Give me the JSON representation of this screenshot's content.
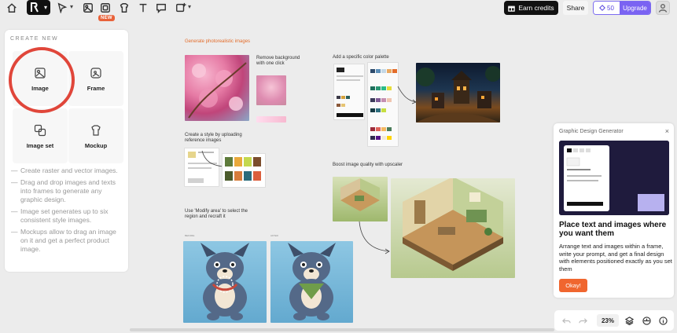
{
  "toolbar": {
    "new_badge": "NEW",
    "earn_credits": "Earn credits",
    "share": "Share",
    "credits": "50",
    "upgrade": "Upgrade"
  },
  "left_panel": {
    "create_new": "CREATE NEW",
    "tiles": [
      {
        "label": "Image",
        "icon": "image-icon"
      },
      {
        "label": "Frame",
        "icon": "frame-icon"
      },
      {
        "label": "Image set",
        "icon": "image-set-icon"
      },
      {
        "label": "Mockup",
        "icon": "tshirt-icon"
      }
    ],
    "tips": [
      "Create raster and vector images.",
      "Drag and drop images and texts into frames to generate any graphic design.",
      "Image set generates up to six consistent style images.",
      "Mockups allow to drag an image on it and get a perfect product image."
    ]
  },
  "canvas": {
    "photoreal_title": "Generate photorealistic images",
    "remove_bg_title": "Remove background with one click",
    "color_palette_title": "Add a specific color palette",
    "style_title": "Create a style by uploading reference images",
    "upscaler_title": "Boost image quality with upscaler",
    "modify_title": "Use 'Modify area' to select the region  and recraft it",
    "before_label": "BEFORE",
    "after_label": "AFTER"
  },
  "popup": {
    "title": "Graphic Design Generator",
    "close": "×",
    "heading": "Place text and images where you want them",
    "body": "Arrange text and images within a frame, write your prompt, and get a final design with elements positioned exactly as you set them",
    "okay": "Okay!"
  },
  "zoom": {
    "value": "23%"
  },
  "colors": {
    "accent_orange": "#f0662f",
    "upgrade_purple": "#7a63f2",
    "highlight_red": "#e0463a"
  }
}
